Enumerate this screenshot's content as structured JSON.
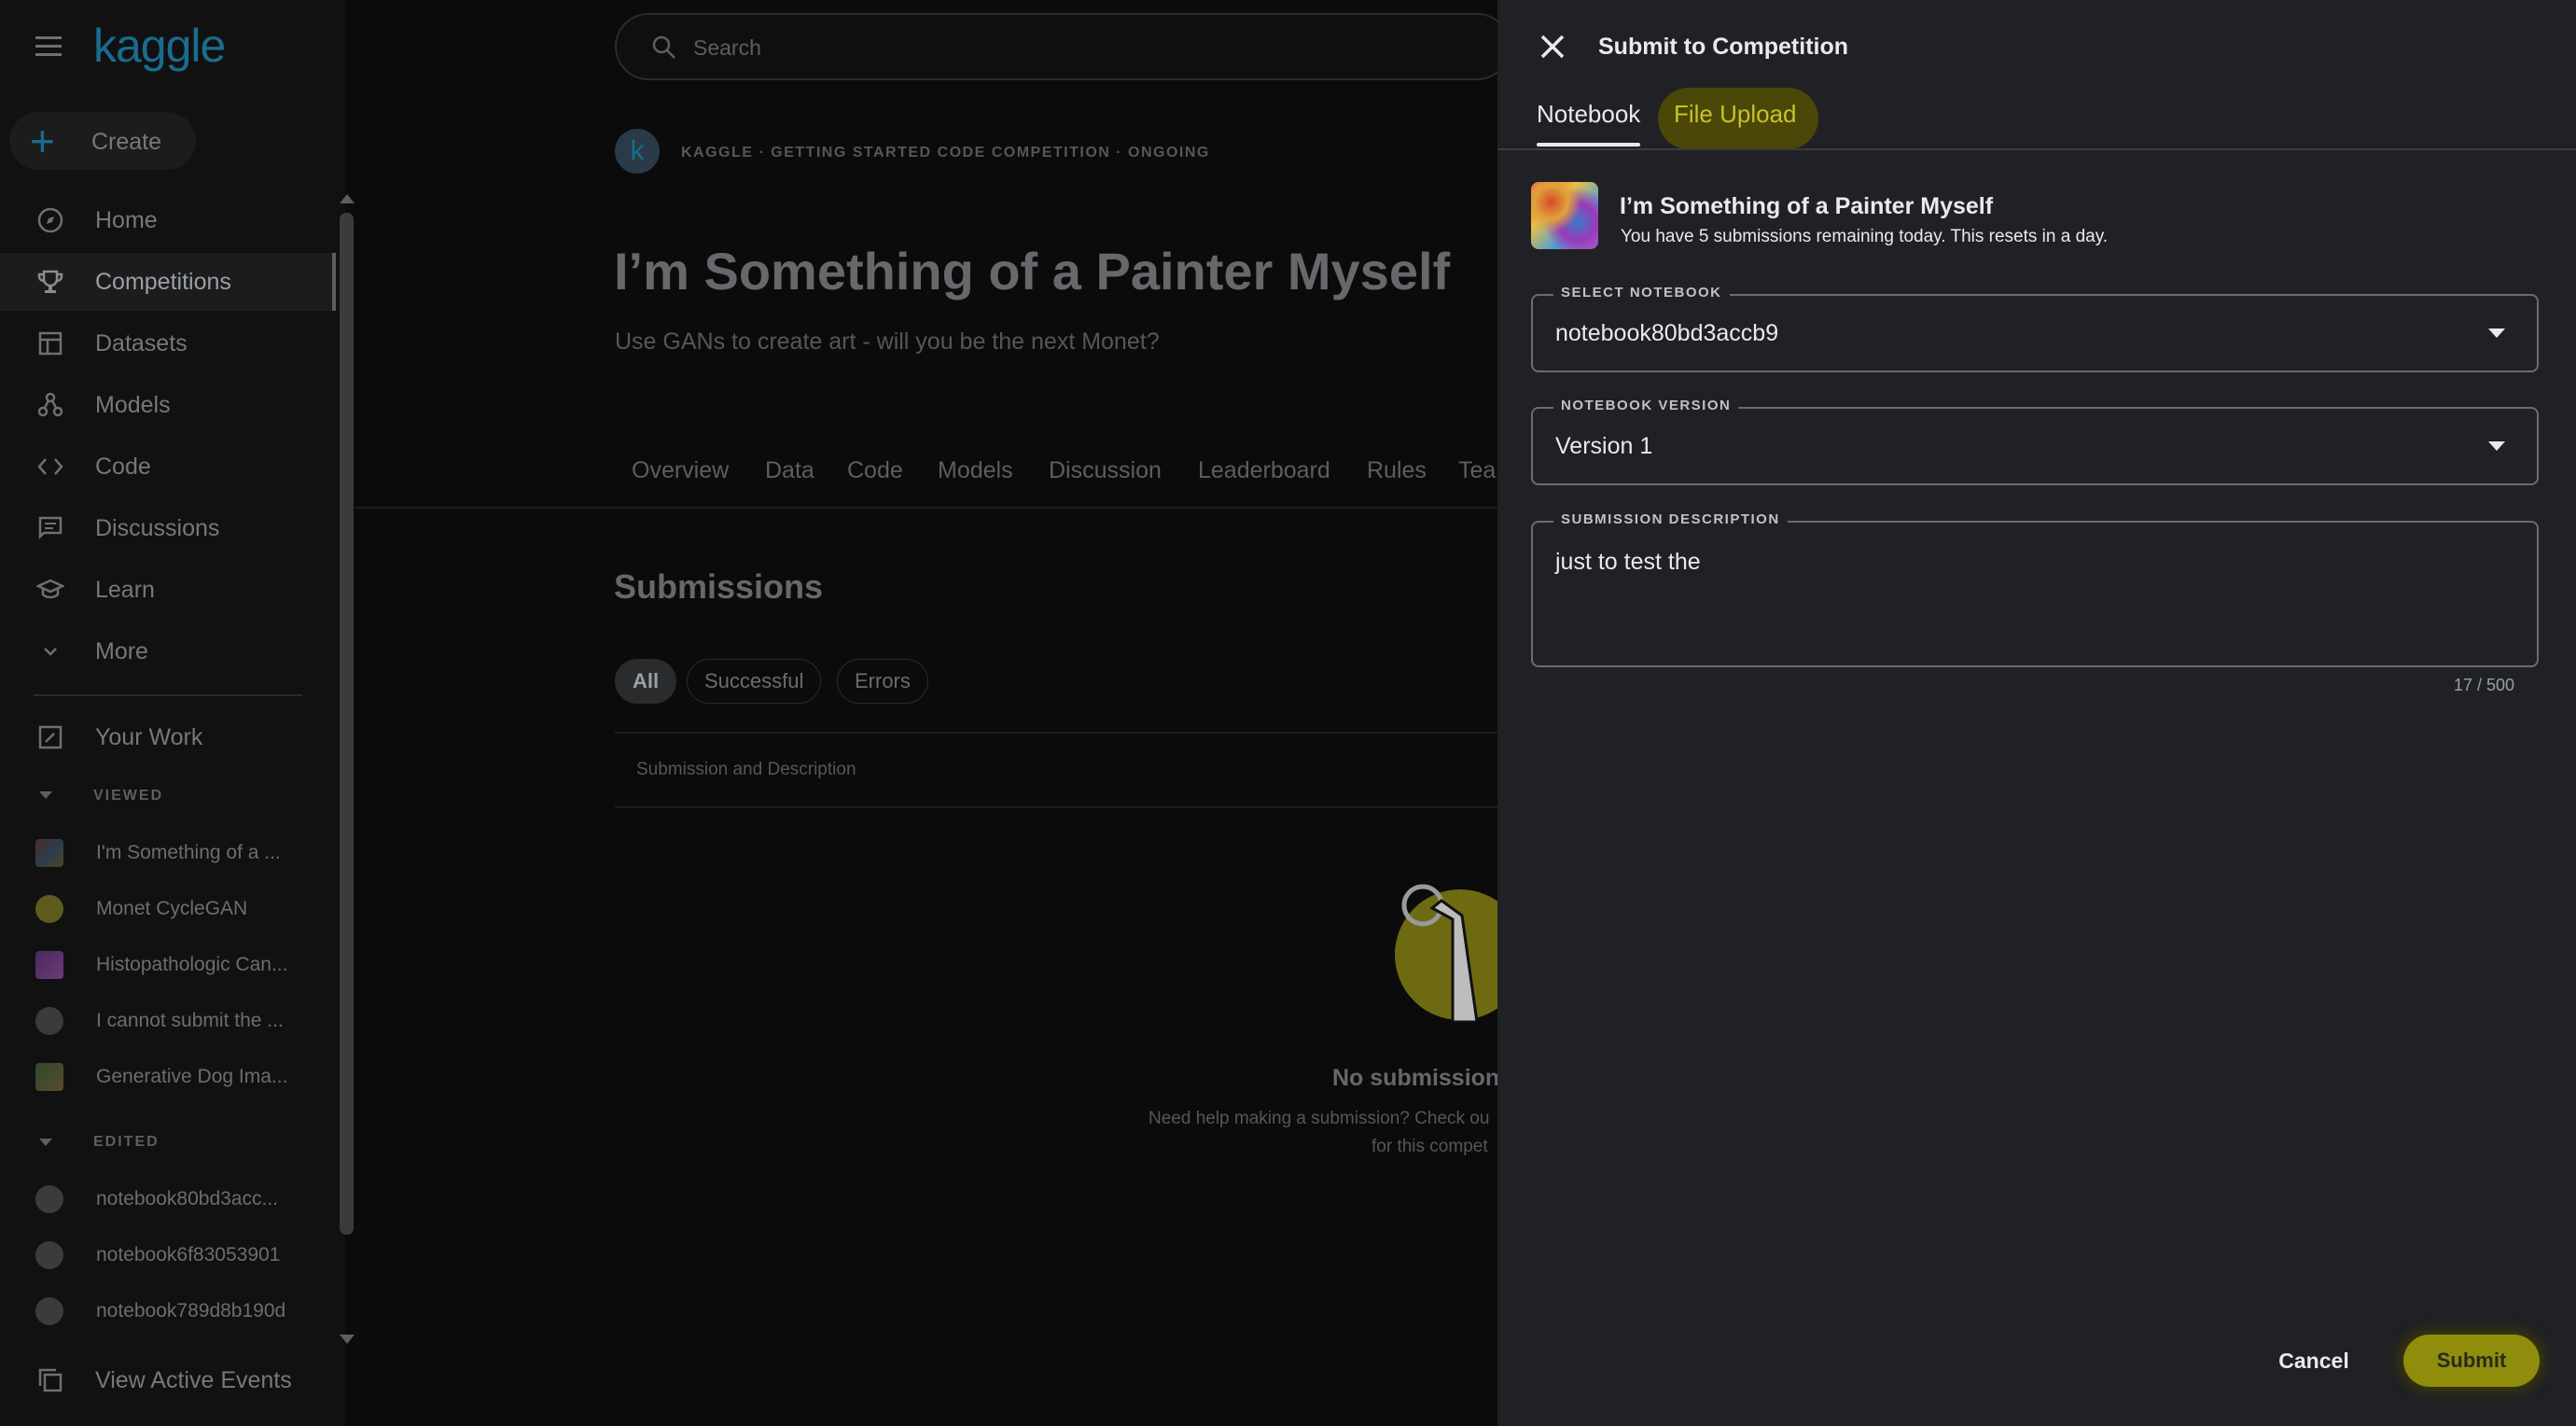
{
  "header": {
    "logo": "kaggle",
    "search_placeholder": "Search",
    "create_label": "Create"
  },
  "sidebar": {
    "items": [
      {
        "label": "Home",
        "icon": "compass-icon"
      },
      {
        "label": "Competitions",
        "icon": "trophy-icon"
      },
      {
        "label": "Datasets",
        "icon": "table-icon"
      },
      {
        "label": "Models",
        "icon": "models-icon"
      },
      {
        "label": "Code",
        "icon": "code-icon"
      },
      {
        "label": "Discussions",
        "icon": "discussion-icon"
      },
      {
        "label": "Learn",
        "icon": "school-icon"
      },
      {
        "label": "More",
        "icon": "chevron-down-icon"
      }
    ],
    "your_work": "Your Work",
    "viewed_title": "VIEWED",
    "viewed": [
      "I'm Something of a ...",
      "Monet CycleGAN",
      "Histopathologic Can...",
      "I cannot submit the ...",
      "Generative Dog Ima..."
    ],
    "edited_title": "EDITED",
    "edited": [
      "notebook80bd3acc...",
      "notebook6f83053901",
      "notebook789d8b190d"
    ],
    "view_active_events": "View Active Events"
  },
  "competition": {
    "avatar_letter": "k",
    "breadcrumb": "KAGGLE · GETTING STARTED CODE COMPETITION · ONGOING",
    "title": "I’m Something of a Painter Myself",
    "subtitle": "Use GANs to create art - will you be the next Monet?",
    "tabs": [
      "Overview",
      "Data",
      "Code",
      "Models",
      "Discussion",
      "Leaderboard",
      "Rules",
      "Tea"
    ],
    "submissions_heading": "Submissions",
    "filters": [
      "All",
      "Successful",
      "Errors"
    ],
    "column_header": "Submission and Description",
    "empty_title": "No submissions",
    "empty_text_1": "Need help making a submission? Check ou",
    "empty_text_2": "for this compet"
  },
  "dialog": {
    "title": "Submit to Competition",
    "tabs": {
      "notebook": "Notebook",
      "file_upload": "File Upload"
    },
    "competition_name": "I’m Something of a Painter Myself",
    "remaining_text": "You have 5 submissions remaining today. This resets in a day.",
    "select_notebook": {
      "label": "SELECT NOTEBOOK",
      "value": "notebook80bd3accb9"
    },
    "notebook_version": {
      "label": "NOTEBOOK VERSION",
      "value": "Version 1"
    },
    "description": {
      "label": "SUBMISSION DESCRIPTION",
      "value": "just to test the",
      "counter": "17 / 500"
    },
    "cancel_label": "Cancel",
    "submit_label": "Submit"
  },
  "colors": {
    "highlight": "#8f8d0b",
    "dialog_bg": "#202124",
    "kaggle_blue": "#20beff"
  }
}
